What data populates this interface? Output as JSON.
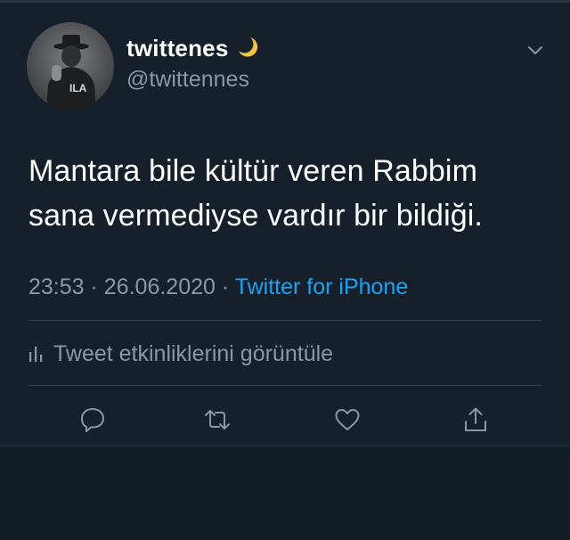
{
  "user": {
    "display_name": "twittenes",
    "handle": "@twittennes",
    "name_emoji": "crescent-moon-icon",
    "avatar": "profile-photo-grayscale"
  },
  "tweet": {
    "lines": [
      "Mantara bile kültür veren Rabbim",
      "sana vermediyse vardır bir bildiği."
    ],
    "time": "23:53",
    "separator": "·",
    "date": "26.06.2020",
    "source": "Twitter for iPhone"
  },
  "activity": {
    "label": "Tweet etkinliklerini görüntüle",
    "icon": "analytics-bars-icon"
  },
  "actions": [
    {
      "name": "reply",
      "icon": "reply-icon"
    },
    {
      "name": "retweet",
      "icon": "retweet-icon"
    },
    {
      "name": "like",
      "icon": "heart-icon"
    },
    {
      "name": "share",
      "icon": "share-icon"
    }
  ],
  "colors": {
    "background": "#15202b",
    "text_primary": "#ffffff",
    "text_secondary": "#8899a6",
    "link": "#1da1f2",
    "divider": "#38444d",
    "moon": "#f5c242"
  }
}
